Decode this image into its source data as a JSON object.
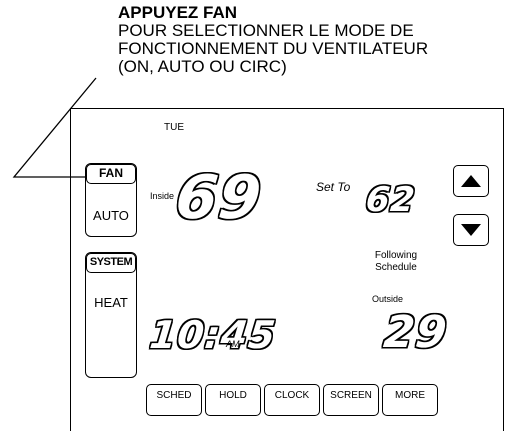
{
  "caption": {
    "heading": "APPUYEZ FAN",
    "lines": [
      "POUR SELECTIONNER LE MODE DE",
      "FONCTIONNEMENT DU VENTILATEUR",
      "(ON, AUTO OU CIRC)"
    ]
  },
  "display": {
    "day": "TUE",
    "fan_button": "FAN",
    "fan_mode": "AUTO",
    "system_button": "SYSTEM",
    "system_mode": "HEAT",
    "inside_label": "Inside",
    "inside_temp": "69",
    "set_to_label": "Set To",
    "set_temp": "62",
    "status_line1": "Following",
    "status_line2": "Schedule",
    "outside_label": "Outside",
    "outside_temp": "29",
    "time": "10:45",
    "am_pm": "AM"
  },
  "buttons": {
    "up": "up-arrow-icon",
    "down": "down-arrow-icon",
    "bottom": [
      "SCHED",
      "HOLD",
      "CLOCK",
      "SCREEN",
      "MORE"
    ]
  }
}
